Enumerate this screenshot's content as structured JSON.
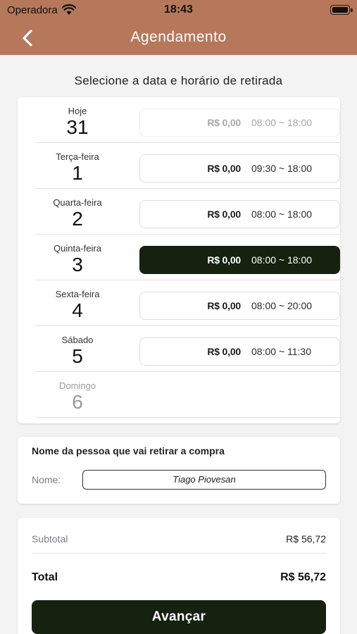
{
  "status_bar": {
    "carrier": "Operadora",
    "time": "18:43"
  },
  "nav": {
    "title": "Agendamento",
    "back_icon": "chevron-left-icon"
  },
  "subtitle": "Selecione a data e horário de retirada",
  "days": [
    {
      "name": "Hoje",
      "number": "31",
      "price": "R$ 0,00",
      "hours": "08:00 ~ 18:00",
      "state": "disabled"
    },
    {
      "name": "Terça-feira",
      "number": "1",
      "price": "R$ 0,00",
      "hours": "09:30 ~ 18:00",
      "state": "normal"
    },
    {
      "name": "Quarta-feira",
      "number": "2",
      "price": "R$ 0,00",
      "hours": "08:00 ~ 18:00",
      "state": "normal"
    },
    {
      "name": "Quinta-feira",
      "number": "3",
      "price": "R$ 0,00",
      "hours": "08:00 ~ 18:00",
      "state": "selected"
    },
    {
      "name": "Sexta-feira",
      "number": "4",
      "price": "R$ 0,00",
      "hours": "08:00 ~ 20:00",
      "state": "normal"
    },
    {
      "name": "Sábado",
      "number": "5",
      "price": "R$ 0,00",
      "hours": "08:00 ~ 11:30",
      "state": "normal"
    },
    {
      "name": "Domingo",
      "number": "6",
      "state": "closed"
    }
  ],
  "pickup": {
    "label": "Nome da pessoa que vai retirar a compra",
    "field_label": "Nome:",
    "name_value": "Tiago Piovesan"
  },
  "summary": {
    "subtotal_label": "Subtotal",
    "subtotal_value": "R$ 56,72",
    "total_label": "Total",
    "total_value": "R$ 56,72",
    "advance_label": "Avançar"
  },
  "colors": {
    "header": "#b7775a",
    "primary": "#14220f",
    "background": "#f3f3f3"
  }
}
